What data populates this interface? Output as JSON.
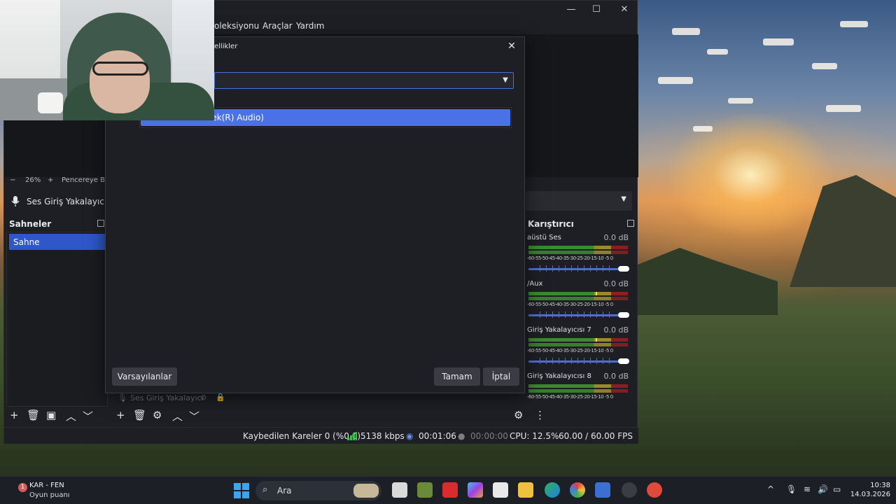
{
  "obs": {
    "menu": {
      "item1": "oleksiyonu",
      "item2": "Araçlar",
      "item3": "Yardım"
    },
    "window_controls": {
      "minimize": "—",
      "maximize": "☐",
      "close": "✕"
    },
    "zoom": {
      "minus": "−",
      "value": "26%",
      "plus": "+",
      "fit_label": "Pencereye Boy"
    },
    "source_strip_label": "Ses Giriş Yakalayıcısı 8",
    "scenes": {
      "title": "Sahneler",
      "items": [
        "Sahne"
      ]
    },
    "sources_item_label": "Ses Giriş Yakalayıcı",
    "mixer": {
      "title": "Karıştırıcı",
      "scale_text": "-60-55-50-45-40-35-30-25-20-15-10 -5 0",
      "tracks": [
        {
          "name": "aüstü Ses",
          "db": "0.0 dB"
        },
        {
          "name": "/Aux",
          "db": "0.0 dB"
        },
        {
          "name": "Giriş Yakalayıcısı 7",
          "db": "0.0 dB"
        },
        {
          "name": "Giriş Yakalayıcısı 8",
          "db": "0.0 dB"
        }
      ]
    },
    "status": {
      "dropped": "Kaybedilen Kareler 0 (%0.0)",
      "bitrate": "5138 kbps",
      "stream_time": "00:01:06",
      "rec_time": "00:00:00",
      "cpu": "CPU: 12.5%",
      "fps": "60.00 / 60.00 FPS"
    }
  },
  "dialog": {
    "title": "ellikler",
    "close": "✕",
    "dropdown_arrow": "▼",
    "selected_option": "altek(R) Audio)",
    "defaults_button": "Varsayılanlar",
    "ok_button": "Tamam",
    "cancel_button": "İptal"
  },
  "taskbar": {
    "weather_badge": "1",
    "weather_line1": "KAR - FEN",
    "weather_line2": "Oyun puanı",
    "search_placeholder": "Ara",
    "search_icon": "⌕",
    "tray_chevron": "^",
    "time": "10:38",
    "date": "14.03.2026"
  },
  "colors": {
    "accent": "#2f57c9",
    "dialog_selection": "#4a72e6",
    "obs_bg": "#1e1f24"
  }
}
